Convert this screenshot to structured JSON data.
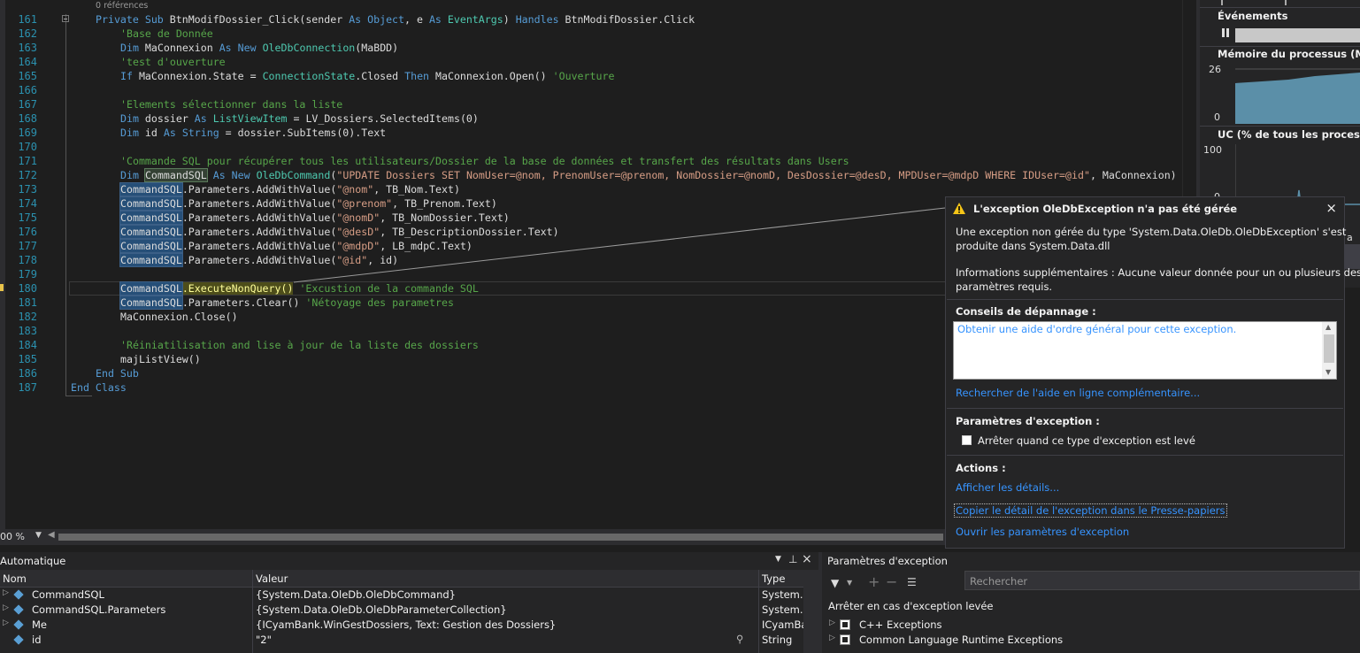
{
  "editor": {
    "refs": "0 références",
    "zoom": "00 %",
    "lines": [
      {
        "n": "161",
        "code": "<span class='kw'>Private Sub</span> BtnModifDossier_Click(sender <span class='kw'>As Object</span>, e <span class='kw'>As</span> <span class='ty'>EventArgs</span>) <span class='kw'>Handles</span> BtnModifDossier.Click",
        "ind": 28
      },
      {
        "n": "162",
        "code": "<span class='cm'>'Base de Donnée</span>",
        "ind": 56
      },
      {
        "n": "163",
        "code": "<span class='kw'>Dim</span> MaConnexion <span class='kw'>As New</span> <span class='ty'>OleDbConnection</span>(MaBDD)",
        "ind": 56
      },
      {
        "n": "164",
        "code": "<span class='cm'>'test d'ouverture</span>",
        "ind": 56
      },
      {
        "n": "165",
        "code": "<span class='kw'>If</span> MaConnexion.State = <span class='ty'>ConnectionState</span>.Closed <span class='kw'>Then</span> MaConnexion.Open() <span class='cm'>'Ouverture</span>",
        "ind": 56
      },
      {
        "n": "166",
        "code": "",
        "ind": 56
      },
      {
        "n": "167",
        "code": "<span class='cm'>'Elements sélectionner dans la liste</span>",
        "ind": 56
      },
      {
        "n": "168",
        "code": "<span class='kw'>Dim</span> dossier <span class='kw'>As</span> <span class='ty'>ListViewItem</span> = LV_Dossiers.SelectedItems(0)",
        "ind": 56
      },
      {
        "n": "169",
        "code": "<span class='kw'>Dim</span> id <span class='kw'>As String</span> = dossier.SubItems(0).Text",
        "ind": 56
      },
      {
        "n": "170",
        "code": "",
        "ind": 56
      },
      {
        "n": "171",
        "code": "<span class='cm'>'Commande SQL pour récupérer tous les utilisateurs/Dossier de la base de données et transfert des résultats dans Users</span>",
        "ind": 56
      },
      {
        "n": "172",
        "code": "<span class='kw'>Dim</span> <span class='hl2'>CommandSQL</span> <span class='kw'>As New</span> <span class='ty'>OleDbCommand</span>(<span class='st'>\"UPDATE Dossiers SET NomUser=@nom, PrenomUser=@prenom, NomDossier=@nomD, DesDossier=@desD, MPDUser=@mdpD WHERE IDUser=@id\"</span>, MaConnexion)",
        "ind": 56
      },
      {
        "n": "173",
        "code": "<span class='hl'>CommandSQL</span>.Parameters.AddWithValue(<span class='st'>\"@nom\"</span>, TB_Nom.Text)",
        "ind": 56
      },
      {
        "n": "174",
        "code": "<span class='hl'>CommandSQL</span>.Parameters.AddWithValue(<span class='st'>\"@prenom\"</span>, TB_Prenom.Text)",
        "ind": 56
      },
      {
        "n": "175",
        "code": "<span class='hl'>CommandSQL</span>.Parameters.AddWithValue(<span class='st'>\"@nomD\"</span>, TB_NomDossier.Text)",
        "ind": 56
      },
      {
        "n": "176",
        "code": "<span class='hl'>CommandSQL</span>.Parameters.AddWithValue(<span class='st'>\"@desD\"</span>, TB_DescriptionDossier.Text)",
        "ind": 56
      },
      {
        "n": "177",
        "code": "<span class='hl'>CommandSQL</span>.Parameters.AddWithValue(<span class='st'>\"@mdpD\"</span>, LB_mdpC.Text)",
        "ind": 56
      },
      {
        "n": "178",
        "code": "<span class='hl'>CommandSQL</span>.Parameters.AddWithValue(<span class='st'>\"@id\"</span>, id)",
        "ind": 56
      },
      {
        "n": "179",
        "code": "",
        "ind": 56
      },
      {
        "n": "180",
        "code": "<span class='hl'>CommandSQL</span><span class='stmt'>.ExecuteNonQuery()</span> <span class='cm'>'Excustion de la commande SQL</span>",
        "ind": 56
      },
      {
        "n": "181",
        "code": "<span class='hl'>CommandSQL</span>.Parameters.Clear() <span class='cm'>'Nétoyage des parametres</span>",
        "ind": 56
      },
      {
        "n": "182",
        "code": "MaConnexion.Close()",
        "ind": 56
      },
      {
        "n": "183",
        "code": "",
        "ind": 56
      },
      {
        "n": "184",
        "code": "<span class='cm'>'Réiniatilisation and lise à jour de la liste des dossiers</span>",
        "ind": 56
      },
      {
        "n": "185",
        "code": "majListView()",
        "ind": 56
      },
      {
        "n": "186",
        "code": "<span class='kw'>End Sub</span>",
        "ind": 28
      },
      {
        "n": "187",
        "code": "<span class='kw'>End Class</span>",
        "ind": 0
      }
    ]
  },
  "diagnostics": {
    "events_title": "Événements",
    "memory_title": "Mémoire du processus (Mo)",
    "memory_max": "26",
    "memory_min": "0",
    "cpu_title": "UC (% de tous les processeurs)",
    "cpu_max": "100",
    "cpu_min": "0",
    "partial_label": "a n"
  },
  "popup": {
    "title": "L'exception OleDbException n'a pas été gérée",
    "desc1": "Une exception non gérée du type 'System.Data.OleDb.OleDbException' s'est",
    "desc2": "produite dans System.Data.dll",
    "info1": "Informations supplémentaires : Aucune valeur donnée pour un ou plusieurs des",
    "info2": "paramètres requis.",
    "tips_title": "Conseils de dépannage :",
    "tip_link": "Obtenir une aide d'ordre général pour cette exception.",
    "search_link": "Rechercher de l'aide en ligne complémentaire...",
    "params_title": "Paramètres d'exception :",
    "checkbox_label": "Arrêter quand ce type d'exception est levé",
    "actions_title": "Actions :",
    "action1": "Afficher les détails...",
    "action2": "Copier le détail de l'exception dans le Presse-papiers",
    "action3": "Ouvrir les paramètres d'exception"
  },
  "autos": {
    "title": "Automatique",
    "col_name": "Nom",
    "col_value": "Valeur",
    "col_type": "Type",
    "rows": [
      {
        "name": "CommandSQL",
        "value": "{System.Data.OleDb.OleDbCommand}",
        "type": "System.D"
      },
      {
        "name": "CommandSQL.Parameters",
        "value": "{System.Data.OleDb.OleDbParameterCollection}",
        "type": "System.D"
      },
      {
        "name": "Me",
        "value": "{ICyamBank.WinGestDossiers, Text: Gestion des Dossiers}",
        "type": "ICyamBa"
      },
      {
        "name": "id",
        "value": "\"2\"",
        "type": "String"
      }
    ]
  },
  "excparams": {
    "title": "Paramètres d'exception",
    "search_placeholder": "Rechercher",
    "subtitle": "Arrêter en cas d'exception levée",
    "items": [
      "C++ Exceptions",
      "Common Language Runtime Exceptions"
    ]
  },
  "colors": {
    "accent": "#007acc",
    "link": "#3794ff",
    "warning": "#f5c518"
  }
}
